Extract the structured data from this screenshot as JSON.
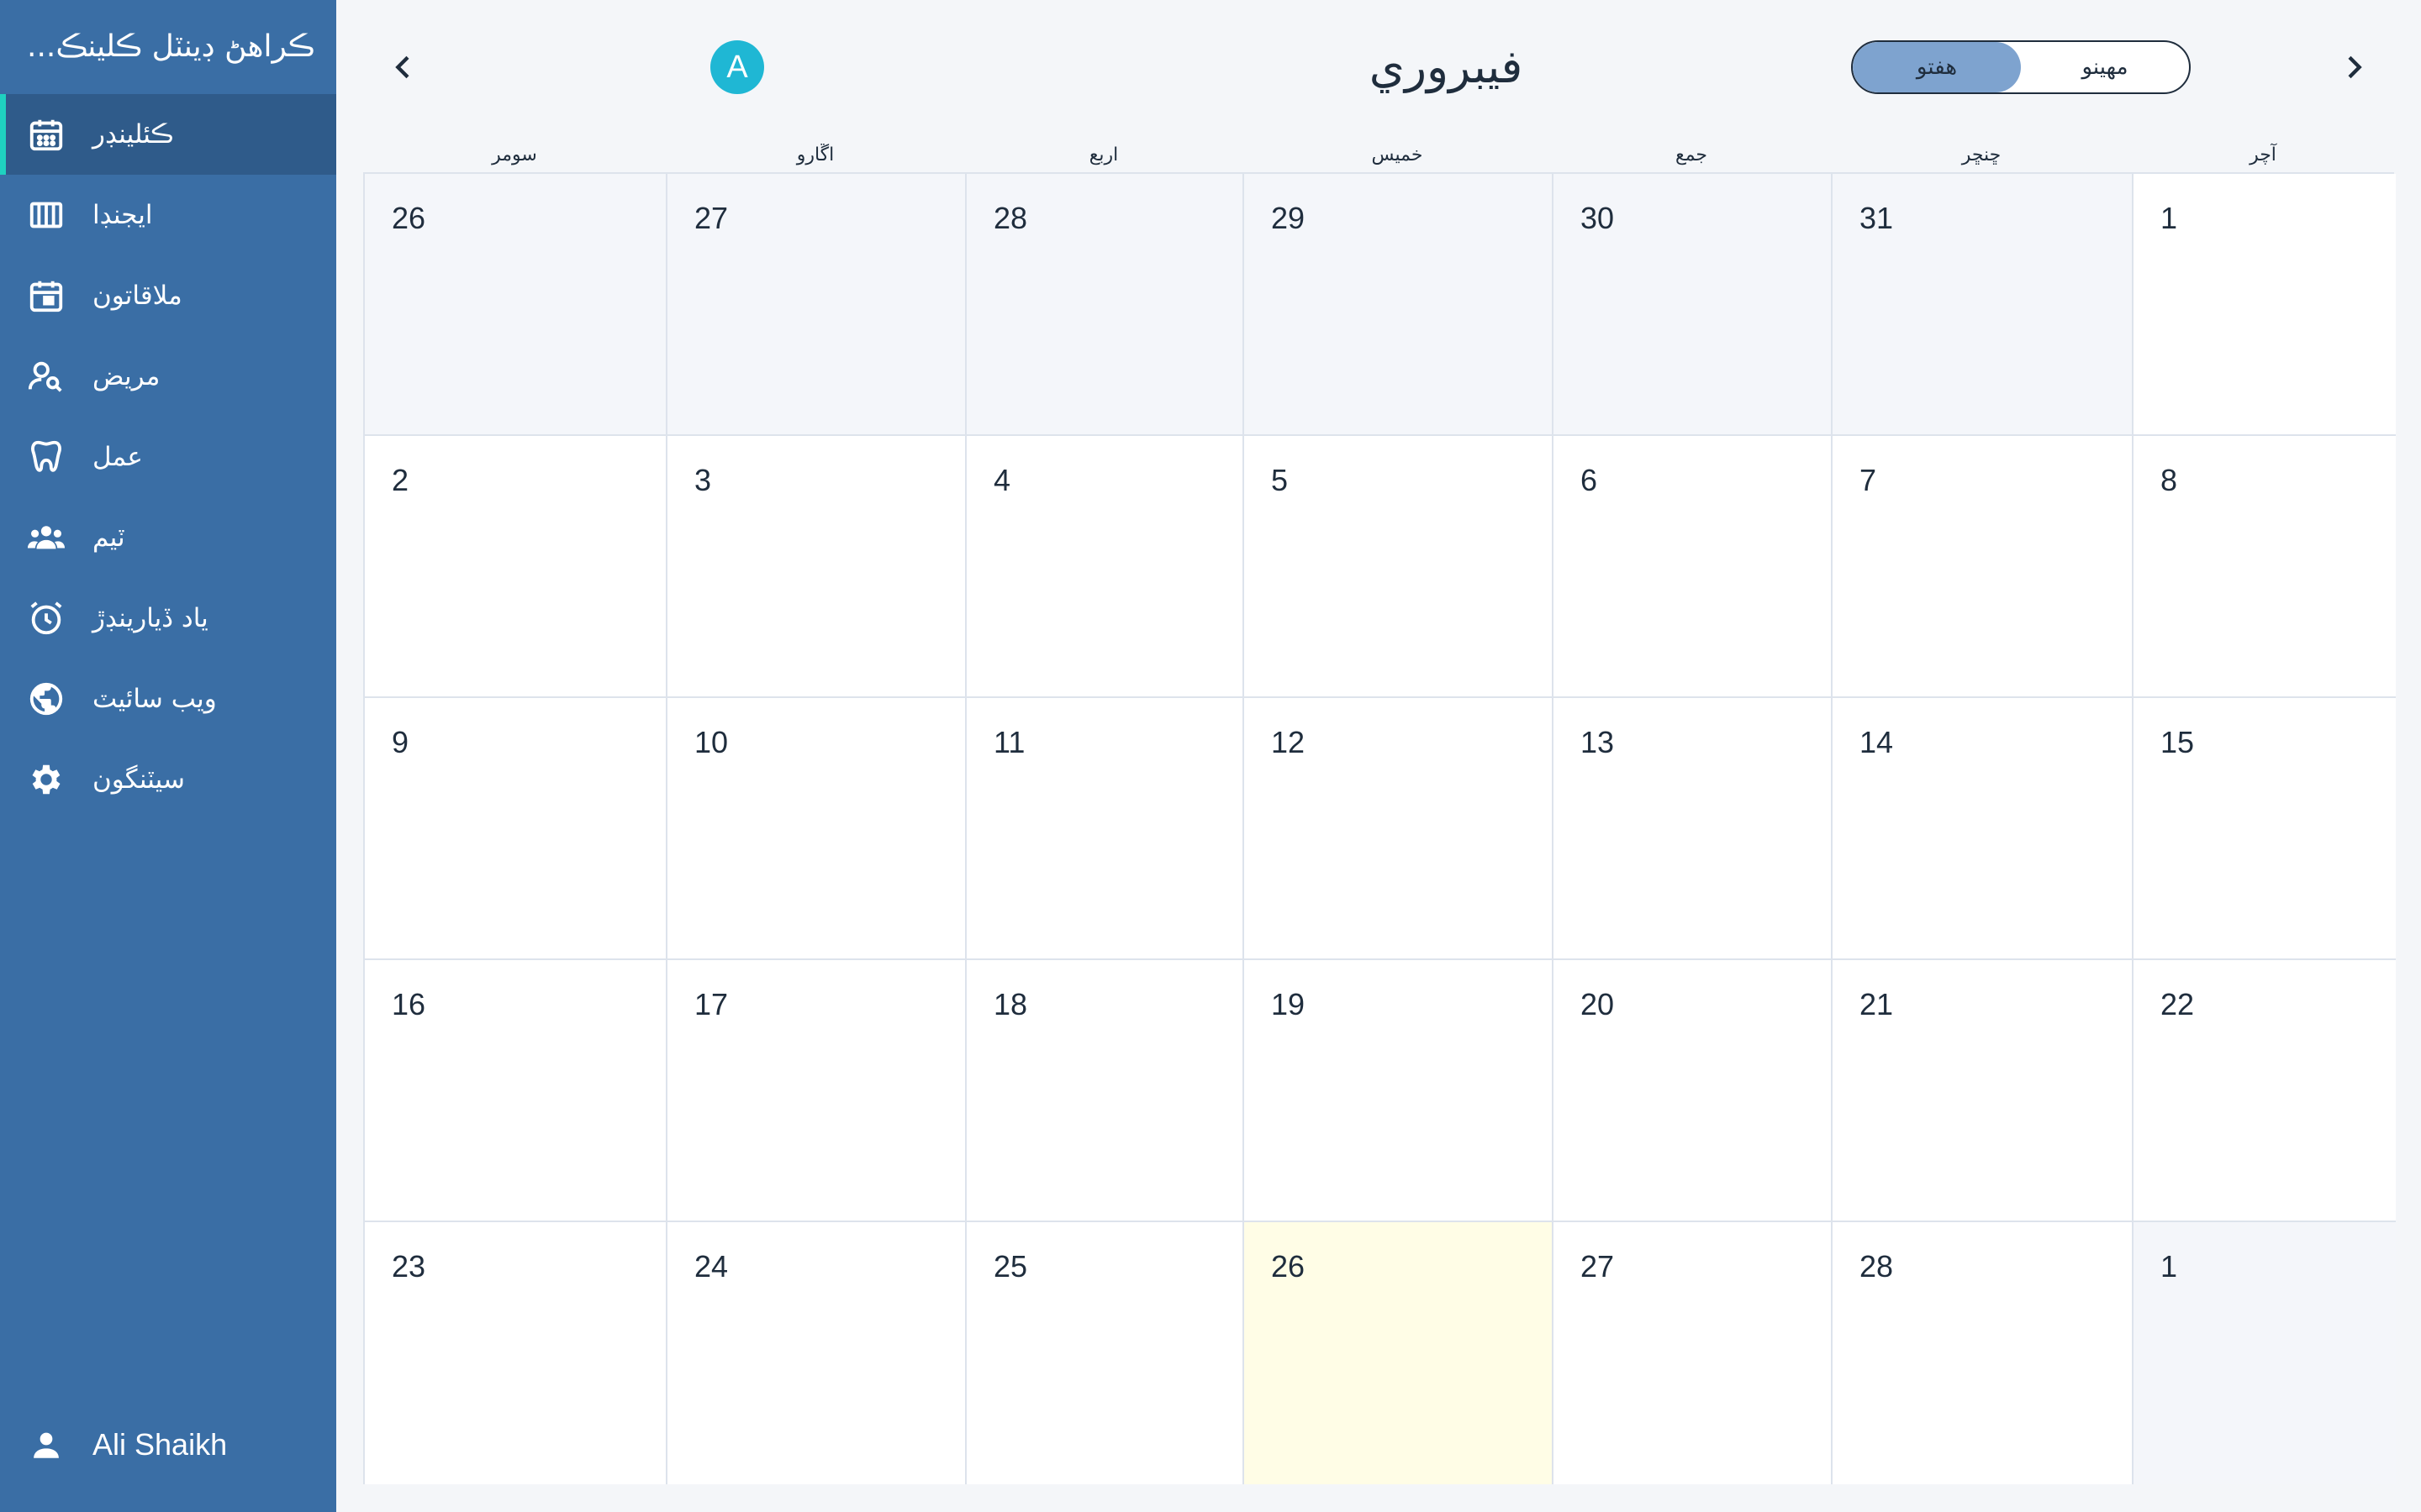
{
  "sidebar": {
    "brand": "...ڪراهڻ ڊينٽل ڪلينڪ",
    "items": [
      {
        "label": "ڪئلينڊر",
        "icon": "calendar-icon",
        "active": true
      },
      {
        "label": "ايجنڊا",
        "icon": "agenda-icon",
        "active": false
      },
      {
        "label": "ملاقاتون",
        "icon": "appointment-icon",
        "active": false
      },
      {
        "label": "مريض",
        "icon": "patient-search-icon",
        "active": false
      },
      {
        "label": "عمل",
        "icon": "tooth-icon",
        "active": false
      },
      {
        "label": "ٽيم",
        "icon": "team-icon",
        "active": false
      },
      {
        "label": "ياد ڏيارينڊڙ",
        "icon": "alarm-icon",
        "active": false
      },
      {
        "label": "ويب سائيٽ",
        "icon": "globe-icon",
        "active": false
      },
      {
        "label": "سيٽنگون",
        "icon": "gear-icon",
        "active": false
      }
    ],
    "user": "Ali Shaikh"
  },
  "header": {
    "month": "فيبروري",
    "avatar_letter": "A",
    "toggle": {
      "week": "هفتو",
      "month": "مهينو",
      "selected": "week"
    }
  },
  "weekdays": [
    "سومر",
    "اڱارو",
    "اربع",
    "خميس",
    "جمع",
    "ڇنڇر",
    "آچر"
  ],
  "weeks": [
    [
      {
        "d": "26",
        "t": "other"
      },
      {
        "d": "27",
        "t": "other"
      },
      {
        "d": "28",
        "t": "other"
      },
      {
        "d": "29",
        "t": "other"
      },
      {
        "d": "30",
        "t": "other"
      },
      {
        "d": "31",
        "t": "other"
      },
      {
        "d": "1",
        "t": "cur"
      }
    ],
    [
      {
        "d": "2",
        "t": "cur"
      },
      {
        "d": "3",
        "t": "cur"
      },
      {
        "d": "4",
        "t": "cur"
      },
      {
        "d": "5",
        "t": "cur"
      },
      {
        "d": "6",
        "t": "cur"
      },
      {
        "d": "7",
        "t": "cur"
      },
      {
        "d": "8",
        "t": "cur"
      }
    ],
    [
      {
        "d": "9",
        "t": "cur"
      },
      {
        "d": "10",
        "t": "cur"
      },
      {
        "d": "11",
        "t": "cur"
      },
      {
        "d": "12",
        "t": "cur"
      },
      {
        "d": "13",
        "t": "cur"
      },
      {
        "d": "14",
        "t": "cur"
      },
      {
        "d": "15",
        "t": "cur"
      }
    ],
    [
      {
        "d": "16",
        "t": "cur"
      },
      {
        "d": "17",
        "t": "cur"
      },
      {
        "d": "18",
        "t": "cur"
      },
      {
        "d": "19",
        "t": "cur"
      },
      {
        "d": "20",
        "t": "cur"
      },
      {
        "d": "21",
        "t": "cur"
      },
      {
        "d": "22",
        "t": "cur"
      }
    ],
    [
      {
        "d": "23",
        "t": "cur"
      },
      {
        "d": "24",
        "t": "cur"
      },
      {
        "d": "25",
        "t": "cur"
      },
      {
        "d": "26",
        "t": "today"
      },
      {
        "d": "27",
        "t": "cur"
      },
      {
        "d": "28",
        "t": "cur"
      },
      {
        "d": "1",
        "t": "other"
      }
    ]
  ],
  "colors": {
    "sidebar": "#3a6ea5",
    "sidebar_active": "#2f5b8a",
    "accent": "#1fd1c0",
    "avatar": "#1fb7d4",
    "today": "#fffde6",
    "toggle_selected": "#7ea3cf"
  }
}
